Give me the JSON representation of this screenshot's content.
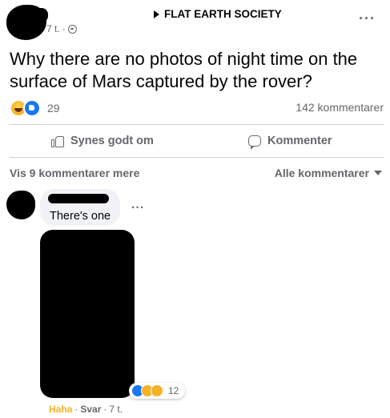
{
  "post": {
    "group_name": "FLAT EARTH SOCIETY",
    "time": "7 t.",
    "separator": "·",
    "text": "Why there are no photos of night time on the surface of Mars captured by the rover?",
    "reaction_count": "29",
    "comment_count": "142 kommentarer"
  },
  "actions": {
    "like_label": "Synes godt om",
    "comment_label": "Kommenter"
  },
  "comments_header": {
    "view_more": "Vis 9 kommentarer mere",
    "sort_label": "Alle kommentarer"
  },
  "comment": {
    "text": "There's one",
    "more": "···",
    "reaction_count": "12",
    "reaction_label": "Haha",
    "reply_label": "Svar",
    "time": "7 t."
  },
  "icons": {
    "post_more": "more-horizontal-icon",
    "audience": "globe-icon",
    "group_arrow": "play-triangle-icon"
  },
  "colors": {
    "secondary_text": "#65676b",
    "divider": "#ced0d4",
    "like_blue": "#1877f2",
    "haha_yellow": "#f7b125",
    "bubble_bg": "#f0f2f5"
  }
}
